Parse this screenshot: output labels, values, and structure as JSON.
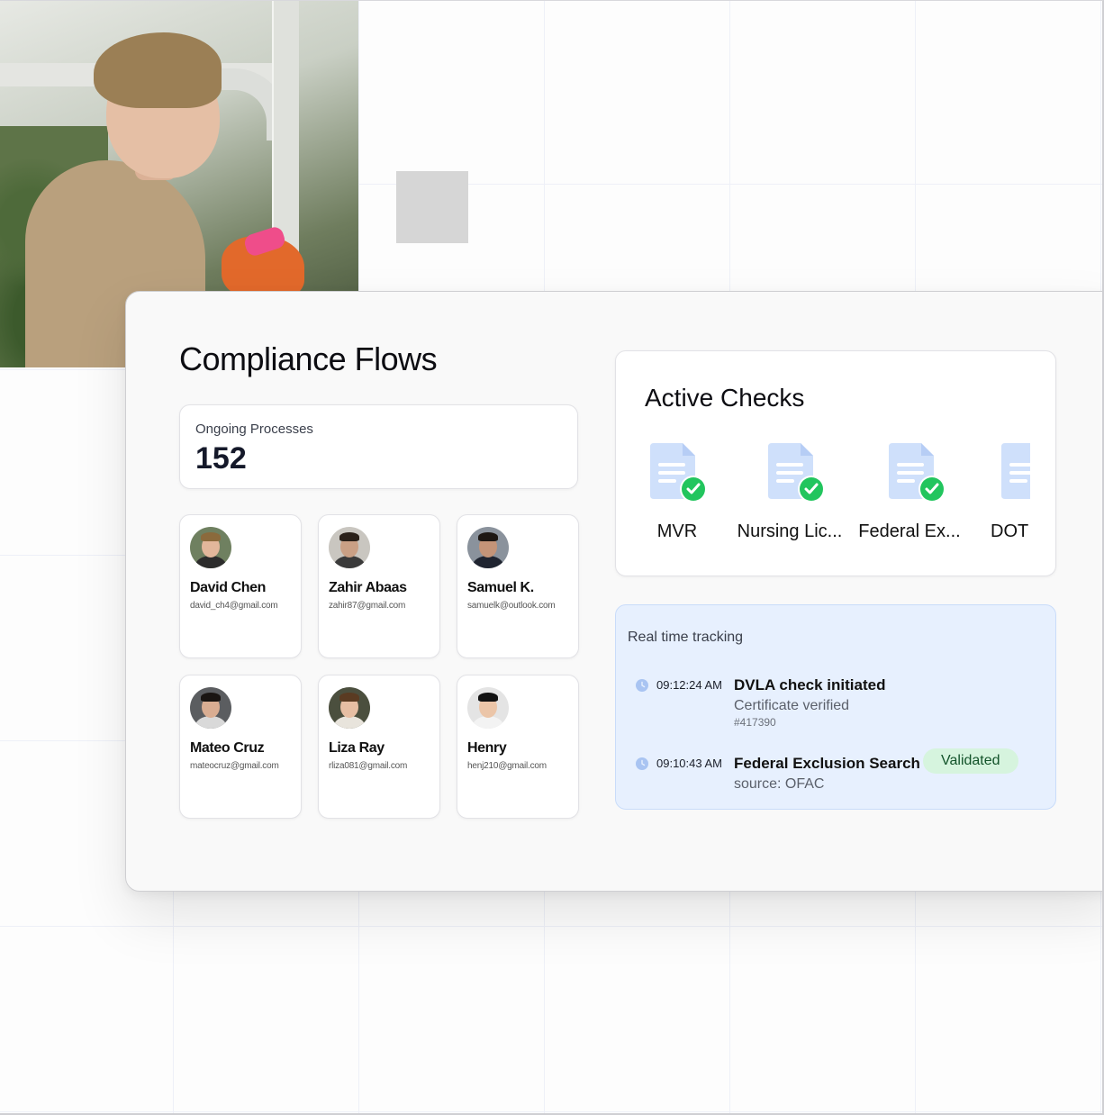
{
  "compliance": {
    "title": "Compliance Flows",
    "ongoing_label": "Ongoing Processes",
    "ongoing_value": "152"
  },
  "people": [
    {
      "name": "David Chen",
      "email": "david_ch4@gmail.com"
    },
    {
      "name": "Zahir Abaas",
      "email": "zahir87@gmail.com"
    },
    {
      "name": "Samuel K.",
      "email": "samuelk@outlook.com"
    },
    {
      "name": "Mateo Cruz",
      "email": "mateocruz@gmail.com"
    },
    {
      "name": "Liza Ray",
      "email": "rliza081@gmail.com"
    },
    {
      "name": "Henry",
      "email": "henj210@gmail.com"
    }
  ],
  "active_checks": {
    "title": "Active Checks",
    "items": [
      {
        "label": "MVR",
        "icon": "document-check-icon"
      },
      {
        "label": "Nursing Lic...",
        "icon": "document-check-icon"
      },
      {
        "label": "Federal Ex...",
        "icon": "document-check-icon"
      },
      {
        "label": "DOT c",
        "icon": "document-icon"
      }
    ]
  },
  "tracking": {
    "title": "Real time tracking",
    "events": [
      {
        "time": "09:12:24 AM",
        "title": "DVLA check initiated",
        "subtitle": "Certificate verified",
        "id": "#417390"
      },
      {
        "time": "09:10:43 AM",
        "title": "Federal Exclusion Search",
        "subtitle": "source: OFAC",
        "badge": "Validated"
      }
    ]
  },
  "colors": {
    "accent_blue": "#e7f0fe",
    "success_green": "#22c55e",
    "badge_green": "#d6f4de",
    "doc_blue": "#cfe0fb"
  }
}
